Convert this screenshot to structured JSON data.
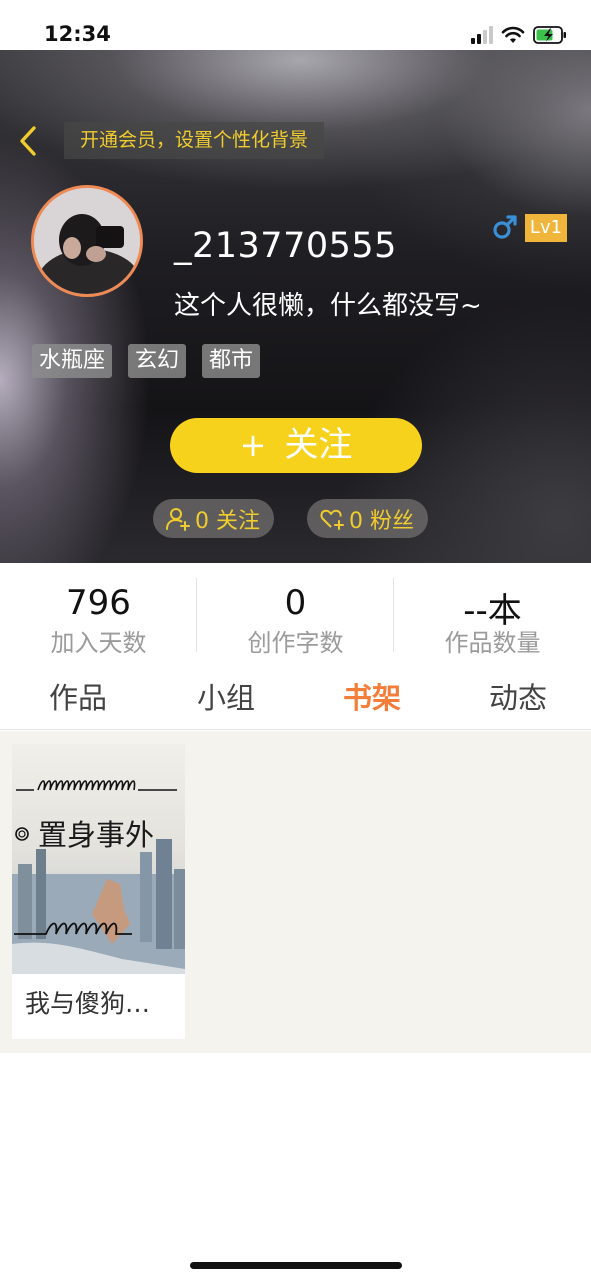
{
  "status_bar": {
    "time": "12:34"
  },
  "header": {
    "vip_banner": "开通会员，设置个性化背景"
  },
  "profile": {
    "username": "_213770555",
    "bio": "这个人很懒，什么都没写~",
    "gender": "male-icon",
    "level": "Lv1",
    "tags": [
      "水瓶座",
      "玄幻",
      "都市"
    ],
    "follow_button": "关注",
    "following": "0 关注",
    "fans": "0 粉丝"
  },
  "stats": [
    {
      "value": "796",
      "label": "加入天数"
    },
    {
      "value": "0",
      "label": "创作字数"
    },
    {
      "value": "--本",
      "label": "作品数量"
    }
  ],
  "tabs": [
    {
      "label": "作品",
      "active": false
    },
    {
      "label": "小组",
      "active": false
    },
    {
      "label": "书架",
      "active": true
    },
    {
      "label": "动态",
      "active": false
    }
  ],
  "bookshelf": [
    {
      "title": "我与傻狗…",
      "cover_text": "置身事外"
    }
  ],
  "colors": {
    "accent_yellow": "#f7d21d",
    "active_tab": "#f47d3a",
    "level_badge": "#f0b53b",
    "banner_text": "#f0cc2e"
  }
}
